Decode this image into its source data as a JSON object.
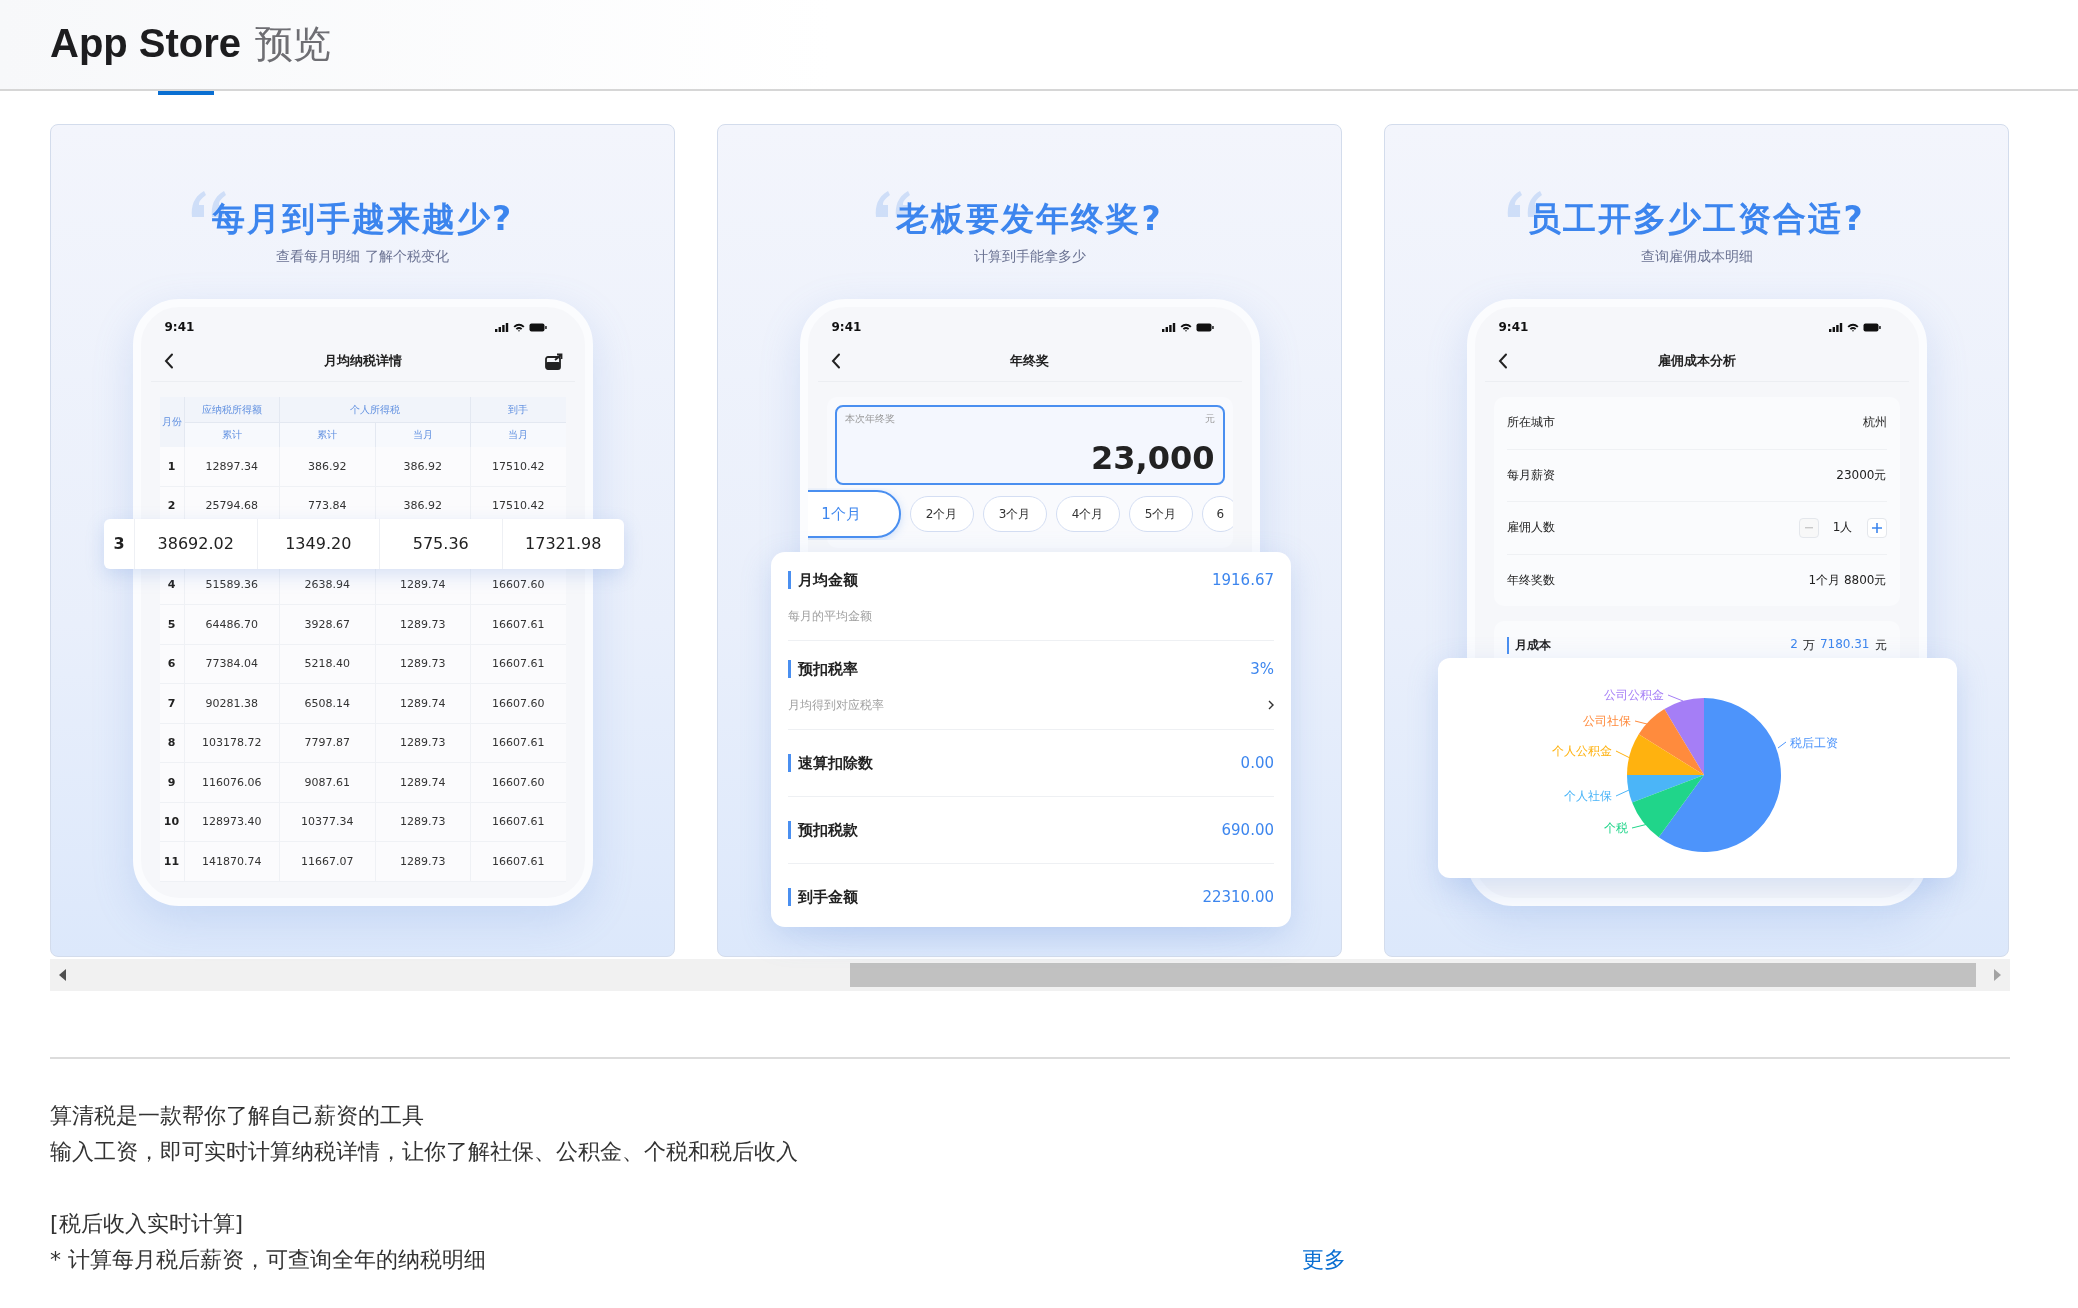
{
  "header": {
    "title": "App Store",
    "subtitle": "预览"
  },
  "screenshots": [
    {
      "kind": "tax_table",
      "headline": "每月到手越来越少?",
      "subheadline": "查看每月明细 了解个税变化",
      "phone": {
        "time": "9:41",
        "title": "月均纳税详情"
      },
      "table": {
        "month_header": "月份",
        "groups": [
          {
            "label": "应纳税所得额",
            "columns": [
              "累计"
            ]
          },
          {
            "label": "个人所得税",
            "columns": [
              "累计",
              "当月"
            ]
          },
          {
            "label": "到手",
            "columns": [
              "当月"
            ]
          }
        ],
        "rows": [
          {
            "cells": [
              "1",
              "12897.34",
              "386.92",
              "386.92",
              "17510.42"
            ],
            "selected": false
          },
          {
            "cells": [
              "2",
              "25794.68",
              "773.84",
              "386.92",
              "17510.42"
            ],
            "selected": false
          },
          {
            "cells": [
              "3",
              "38692.02",
              "1349.20",
              "575.36",
              "17321.98"
            ],
            "selected": true
          },
          {
            "cells": [
              "4",
              "51589.36",
              "2638.94",
              "1289.74",
              "16607.60"
            ],
            "selected": false
          },
          {
            "cells": [
              "5",
              "64486.70",
              "3928.67",
              "1289.73",
              "16607.61"
            ],
            "selected": false
          },
          {
            "cells": [
              "6",
              "77384.04",
              "5218.40",
              "1289.73",
              "16607.61"
            ],
            "selected": false
          },
          {
            "cells": [
              "7",
              "90281.38",
              "6508.14",
              "1289.74",
              "16607.60"
            ],
            "selected": false
          },
          {
            "cells": [
              "8",
              "103178.72",
              "7797.87",
              "1289.73",
              "16607.61"
            ],
            "selected": false
          },
          {
            "cells": [
              "9",
              "116076.06",
              "9087.61",
              "1289.74",
              "16607.60"
            ],
            "selected": false
          },
          {
            "cells": [
              "10",
              "128973.40",
              "10377.34",
              "1289.73",
              "16607.61"
            ],
            "selected": false
          },
          {
            "cells": [
              "11",
              "141870.74",
              "11667.07",
              "1289.73",
              "16607.61"
            ],
            "selected": false
          }
        ]
      }
    },
    {
      "kind": "bonus",
      "headline": "老板要发年终奖?",
      "subheadline": "计算到手能拿多少",
      "phone": {
        "time": "9:41",
        "title": "年终奖"
      },
      "input": {
        "label": "本次年终奖",
        "unit": "元",
        "value": "23,000"
      },
      "chips": [
        {
          "label": "1个月",
          "selected": true
        },
        {
          "label": "2个月",
          "selected": false
        },
        {
          "label": "3个月",
          "selected": false
        },
        {
          "label": "4个月",
          "selected": false
        },
        {
          "label": "5个月",
          "selected": false
        },
        {
          "label": "6",
          "selected": false
        }
      ],
      "results": [
        {
          "title": "月均金额",
          "value": "1916.67",
          "note": "每月的平均金额",
          "arrow": false
        },
        {
          "title": "预扣税率",
          "value": "3%",
          "note": "月均得到对应税率",
          "arrow": true
        },
        {
          "title": "速算扣除数",
          "value": "0.00",
          "arrow": false
        },
        {
          "title": "预扣税款",
          "value": "690.00",
          "arrow": false
        },
        {
          "title": "到手金额",
          "value": "22310.00",
          "arrow": false
        }
      ]
    },
    {
      "kind": "cost",
      "headline": "员工开多少工资合适?",
      "subheadline": "查询雇佣成本明细",
      "phone": {
        "time": "9:41",
        "title": "雇佣成本分析"
      },
      "form": [
        {
          "kind": "text",
          "label": "所在城市",
          "value": "杭州"
        },
        {
          "kind": "text",
          "label": "每月薪资",
          "value": "23000元"
        },
        {
          "kind": "stepper",
          "label": "雇佣人数",
          "value": "1人",
          "minus_disabled": true
        },
        {
          "kind": "text",
          "label": "年终奖数",
          "value": "1个月 8800元"
        }
      ],
      "month_cost": {
        "title": "月成本",
        "parts": [
          {
            "text": "2",
            "accent": true
          },
          {
            "text": "万",
            "accent": false
          },
          {
            "text": "7180.31",
            "accent": true
          },
          {
            "text": "元",
            "accent": false
          }
        ]
      },
      "pie": {
        "slices": [
          {
            "label": "公司公积金",
            "color": "#a57ef6"
          },
          {
            "label": "公司社保",
            "color": "#ff8b3d"
          },
          {
            "label": "税后工资",
            "color": "#4d94fb"
          },
          {
            "label": "个人公积金",
            "color": "#ffb20f"
          },
          {
            "label": "个人社保",
            "color": "#4bb5f8"
          },
          {
            "label": "个税",
            "color": "#20d58a"
          }
        ]
      }
    }
  ],
  "description": {
    "paragraphs": [
      {
        "lines": [
          "算清税是一款帮你了解自己薪资的工具",
          "输入工资，即可实时计算纳税详情，让你了解社保、公积金、个税和税后收入"
        ]
      },
      {
        "lines": [
          "[税后收入实时计算]",
          "* 计算每月税后薪资，可查询全年的纳税明细"
        ]
      }
    ],
    "more_link": "更多"
  }
}
